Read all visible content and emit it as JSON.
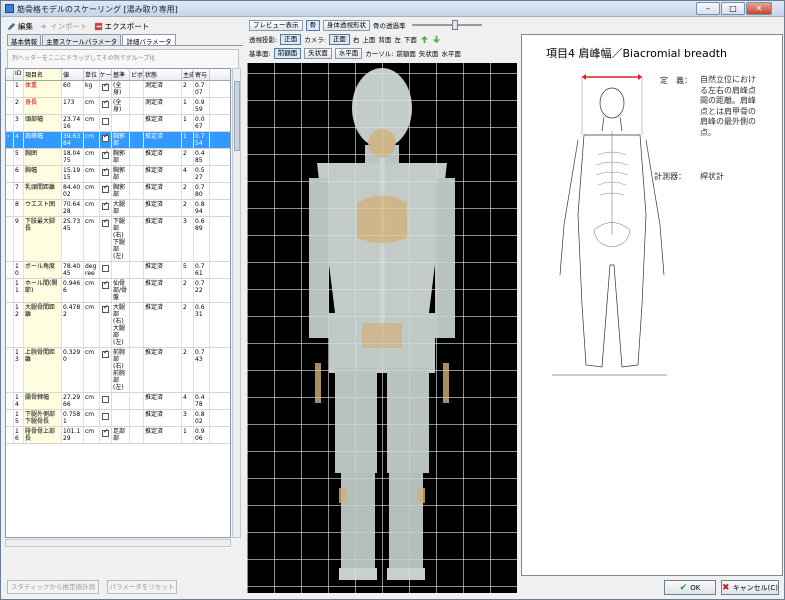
{
  "window": {
    "title": "筋骨格モデルのスケーリング [湯み取り専用]",
    "minimize": "–",
    "maximize": "□",
    "close": "✕"
  },
  "left_toolbar": {
    "edit": "編集",
    "import": "インポート",
    "export": "エクスポート"
  },
  "tabs": [
    "基本情報",
    "主要スケールパラメータ",
    "詳細パラメータ"
  ],
  "hint": "列ヘッダーをここにドラッグしてその列でグループ化",
  "grid": {
    "headers": [
      "",
      "ID",
      "項目名",
      "値",
      "単位",
      "スケール",
      "基準",
      "ピボ",
      "状態",
      "主成分",
      "寄与"
    ],
    "rows": [
      {
        "marker": "",
        "id": "1",
        "name": "体重",
        "value": "60",
        "unit": "kg",
        "scale": true,
        "base": "(全身)",
        "state": "測定済",
        "pc": "2",
        "contrib": "0.707",
        "red": true
      },
      {
        "marker": "",
        "id": "2",
        "name": "身長",
        "value": "173",
        "unit": "cm",
        "scale": true,
        "base": "(全身)",
        "state": "測定済",
        "pc": "1",
        "contrib": "0.959",
        "red": true
      },
      {
        "marker": "",
        "id": "3",
        "name": "頭部幅",
        "value": "23.7416",
        "unit": "cm",
        "scale": false,
        "base": "",
        "state": "推定済",
        "pc": "1",
        "contrib": "0.067",
        "red": false
      },
      {
        "marker": "›",
        "id": "4",
        "name": "肩峰幅",
        "value": "39.6384",
        "unit": "cm",
        "scale": true,
        "base": "胸郭部",
        "state": "推定済",
        "pc": "1",
        "contrib": "0.754",
        "red": false,
        "selected": true
      },
      {
        "marker": "",
        "id": "5",
        "name": "胸囲",
        "value": "18.0475",
        "unit": "cm",
        "scale": true,
        "base": "胸郭部",
        "state": "推定済",
        "pc": "2",
        "contrib": "0.485",
        "red": false
      },
      {
        "marker": "",
        "id": "6",
        "name": "胸幅",
        "value": "15.1915",
        "unit": "cm",
        "scale": true,
        "base": "胸郭部",
        "state": "推定済",
        "pc": "4",
        "contrib": "0.527",
        "red": false
      },
      {
        "marker": "",
        "id": "7",
        "name": "乳頭間距離",
        "value": "84.4002",
        "unit": "cm",
        "scale": true,
        "base": "胸郭部",
        "state": "推定済",
        "pc": "2",
        "contrib": "0.780",
        "red": false
      },
      {
        "marker": "",
        "id": "8",
        "name": "ウエスト囲",
        "value": "70.6428",
        "unit": "cm",
        "scale": true,
        "base": "大腿部",
        "state": "推定済",
        "pc": "2",
        "contrib": "0.894",
        "red": false
      },
      {
        "marker": "",
        "id": "9",
        "name": "下肢最大脚長",
        "value": "25.7345",
        "unit": "cm",
        "scale": true,
        "base": "下腿部(右)下腿部(左)",
        "state": "推定済",
        "pc": "3",
        "contrib": "0.689",
        "red": false
      },
      {
        "marker": "",
        "id": "10",
        "name": "ボール角度",
        "value": "78.4045",
        "unit": "degree",
        "scale": false,
        "base": "",
        "state": "推定済",
        "pc": "5",
        "contrib": "0.761",
        "red": false
      },
      {
        "marker": "",
        "id": "11",
        "name": "ホール間(関節)",
        "value": "0.9466",
        "unit": "cm",
        "scale": true,
        "base": "仙骨部/骨盤",
        "state": "推定済",
        "pc": "2",
        "contrib": "0.722",
        "red": false
      },
      {
        "marker": "",
        "id": "12",
        "name": "大腿骨間距離",
        "value": "0.4782",
        "unit": "cm",
        "scale": true,
        "base": "大腿部(右)大腿部(左)",
        "state": "推定済",
        "pc": "2",
        "contrib": "0.631",
        "red": false
      },
      {
        "marker": "",
        "id": "13",
        "name": "上腕骨間距離",
        "value": "0.3290",
        "unit": "cm",
        "scale": true,
        "base": "前腕部(右)前腕部(左)",
        "state": "推定済",
        "pc": "2",
        "contrib": "0.743",
        "red": false
      },
      {
        "marker": "",
        "id": "14",
        "name": "腸骨棘幅",
        "value": "27.2966",
        "unit": "cm",
        "scale": false,
        "base": "",
        "state": "推定済",
        "pc": "4",
        "contrib": "0.478",
        "red": false
      },
      {
        "marker": "",
        "id": "15",
        "name": "下腿外側部下腿骨長",
        "value": "0.7581",
        "unit": "cm",
        "scale": false,
        "base": "",
        "state": "推定済",
        "pc": "3",
        "contrib": "0.802",
        "red": false
      },
      {
        "marker": "",
        "id": "16",
        "name": "腓骨骨上部長",
        "value": "101.129",
        "unit": "cm",
        "scale": true,
        "base": "足部部",
        "state": "推定済",
        "pc": "1",
        "contrib": "0.906",
        "red": false
      }
    ]
  },
  "left_buttons": {
    "statistics": "スタティックから推定値計測",
    "reset": "パラメータをリセット"
  },
  "mid_toolbar1": {
    "preview": "プレビュー表示",
    "bone": "骨",
    "body": "身体透視形状",
    "transparency_label": "骨の透過率"
  },
  "mid_toolbar2": {
    "projection_label": "透視投影:",
    "projection": "正面",
    "camera_label": "カメラ:",
    "views": [
      "正面",
      "右",
      "上面",
      "背面",
      "左",
      "下面"
    ]
  },
  "mid_toolbar3": {
    "base_label": "基準面:",
    "planes": [
      "前額面",
      "矢状面",
      "水平面"
    ],
    "cursor_label": "カーソル:",
    "cursor_planes": [
      "前額面",
      "矢状面",
      "水平面"
    ]
  },
  "right_panel": {
    "title": "項目4  肩峰幅／Biacromial breadth",
    "definition_label": "定　義：",
    "definition": "自然立位における左右の肩峰点間の距離。肩峰点とは肩甲骨の肩峰の最外側の点。",
    "instrument_label": "計測器：",
    "instrument": "桿状計"
  },
  "footer": {
    "ok": "OK",
    "cancel": "キャンセル(C)"
  },
  "colors": {
    "accent": "#3399ff",
    "measure_line": "#e02020",
    "bone": "#e8c48a",
    "skin": "#d8e2de"
  }
}
